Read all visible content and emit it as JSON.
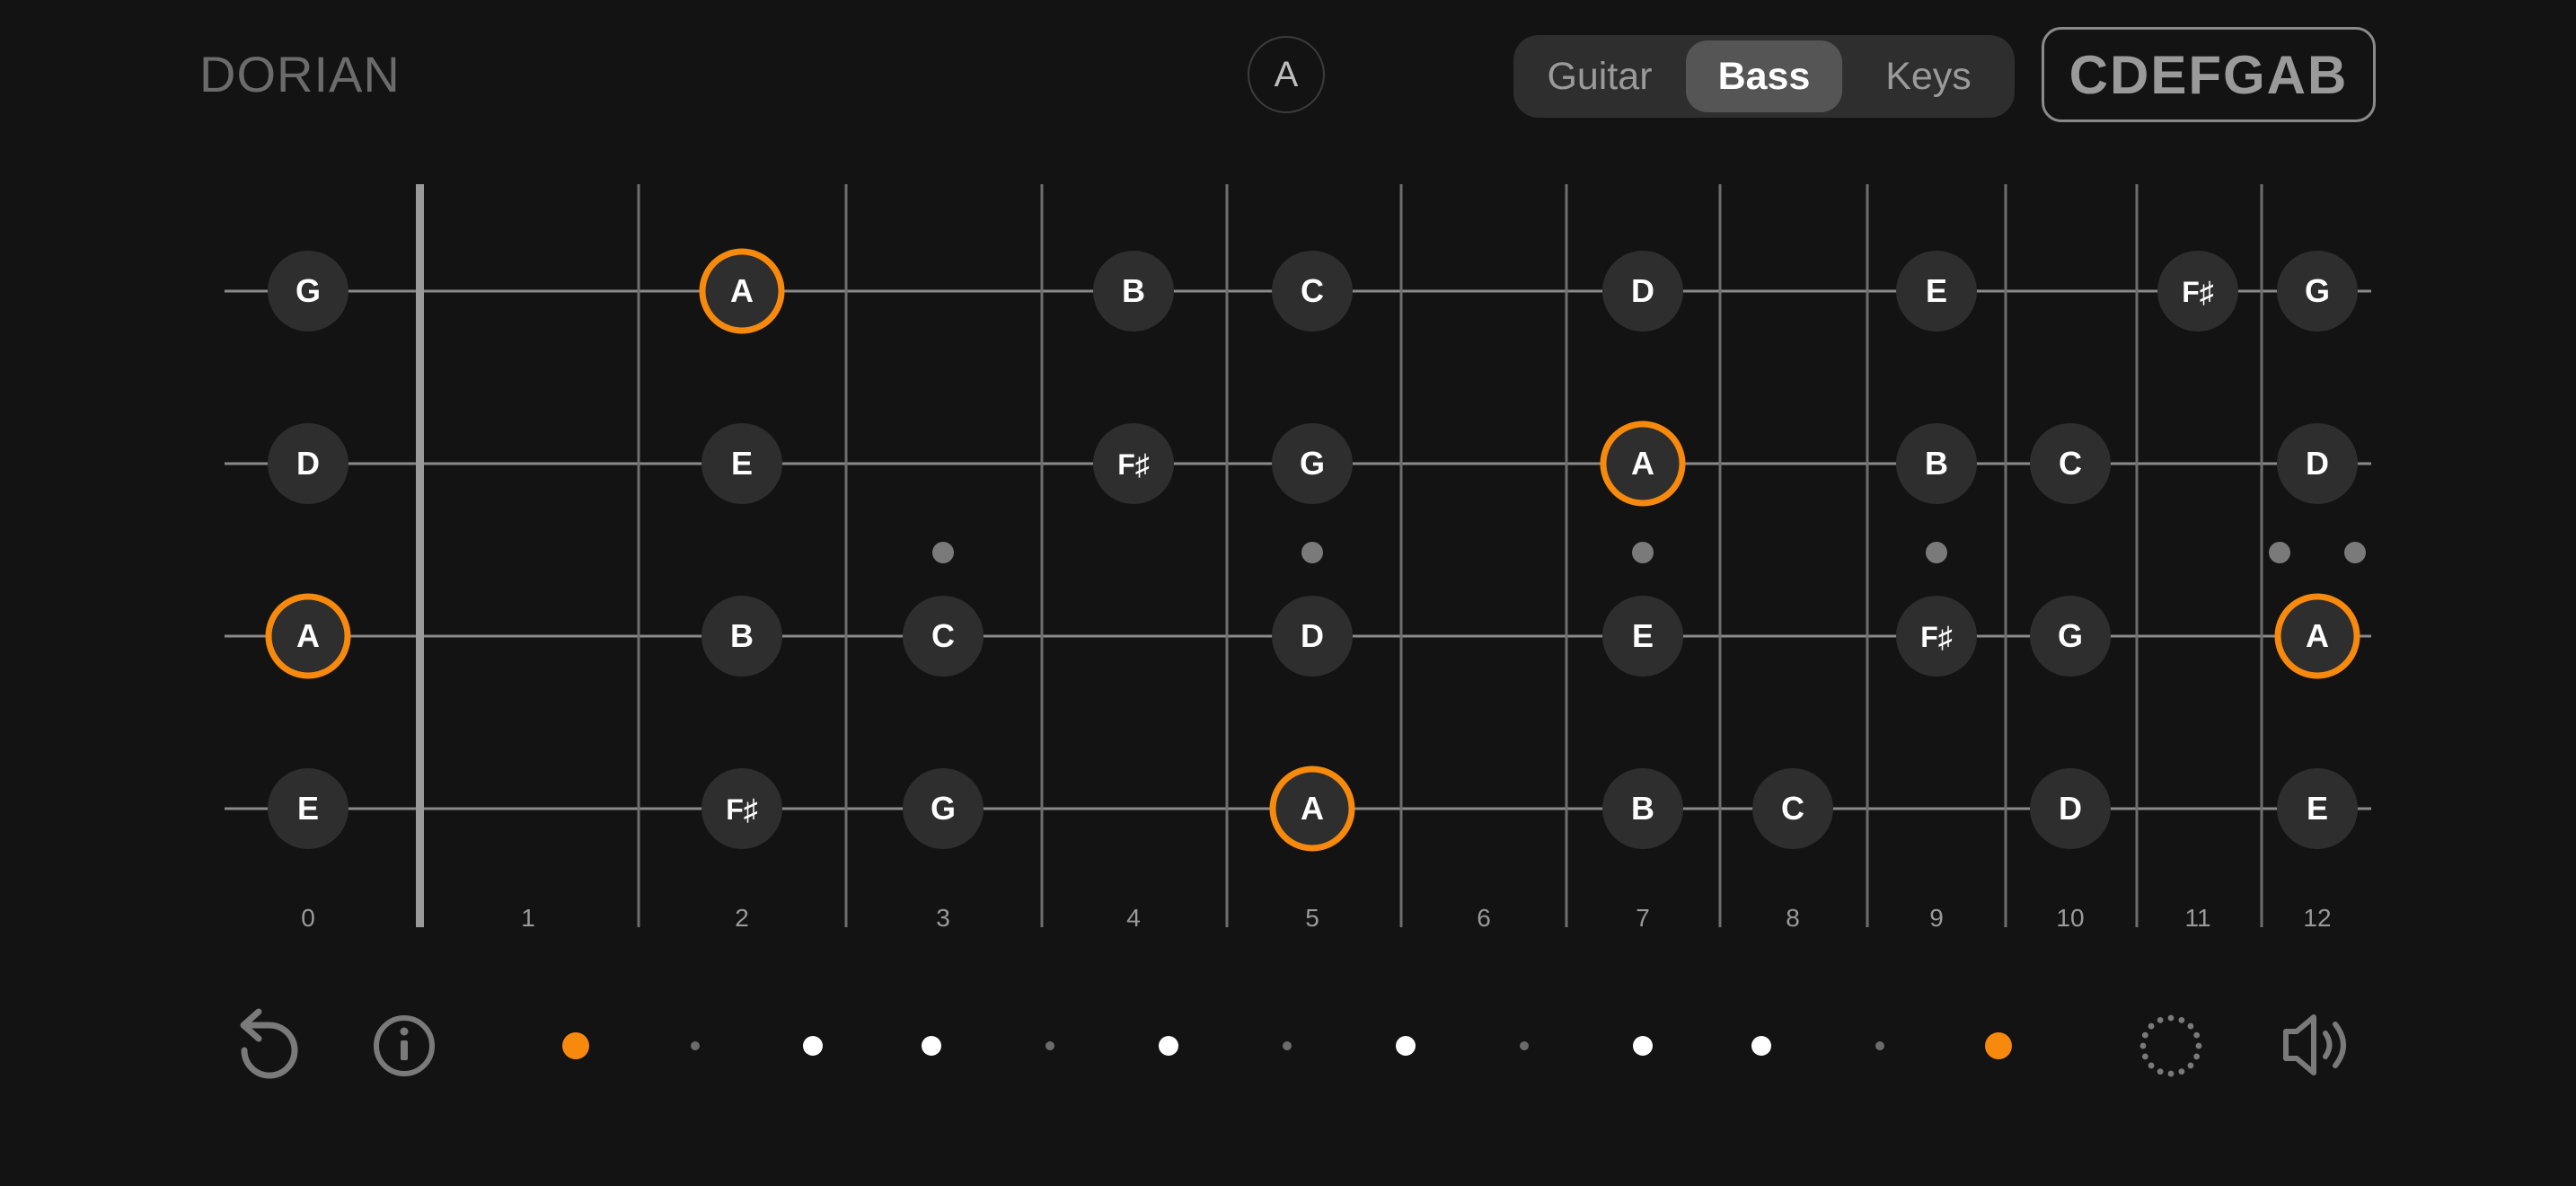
{
  "header": {
    "mode": "DORIAN",
    "root_note": "A",
    "instruments": [
      {
        "label": "Guitar",
        "active": false
      },
      {
        "label": "Bass",
        "active": true
      },
      {
        "label": "Keys",
        "active": false
      }
    ],
    "scale_notes": "CDEFGAB"
  },
  "colors": {
    "background": "#131313",
    "accent": "#f7890c",
    "note_fill": "#2e2e2e",
    "string": "#8a8a8a",
    "fret": "#6e6e6e",
    "nut": "#9a9a9a",
    "marker": "#7a7a7a"
  },
  "fretboard": {
    "fret_numbers": [
      "0",
      "1",
      "2",
      "3",
      "4",
      "5",
      "6",
      "7",
      "8",
      "9",
      "10",
      "11",
      "12"
    ],
    "inlay_frets": [
      3,
      5,
      7,
      9
    ],
    "double_inlay_fret": 12,
    "strings": [
      {
        "name": "G",
        "notes": [
          {
            "fret": 0,
            "label": "G"
          },
          {
            "fret": 2,
            "label": "A",
            "root": true
          },
          {
            "fret": 4,
            "label": "B"
          },
          {
            "fret": 5,
            "label": "C"
          },
          {
            "fret": 7,
            "label": "D"
          },
          {
            "fret": 9,
            "label": "E"
          },
          {
            "fret": 11,
            "label": "F♯"
          },
          {
            "fret": 12,
            "label": "G"
          }
        ]
      },
      {
        "name": "D",
        "notes": [
          {
            "fret": 0,
            "label": "D"
          },
          {
            "fret": 2,
            "label": "E"
          },
          {
            "fret": 4,
            "label": "F♯"
          },
          {
            "fret": 5,
            "label": "G"
          },
          {
            "fret": 7,
            "label": "A",
            "root": true
          },
          {
            "fret": 9,
            "label": "B"
          },
          {
            "fret": 10,
            "label": "C"
          },
          {
            "fret": 12,
            "label": "D"
          }
        ]
      },
      {
        "name": "A",
        "notes": [
          {
            "fret": 0,
            "label": "A",
            "root": true
          },
          {
            "fret": 2,
            "label": "B"
          },
          {
            "fret": 3,
            "label": "C"
          },
          {
            "fret": 5,
            "label": "D"
          },
          {
            "fret": 7,
            "label": "E"
          },
          {
            "fret": 9,
            "label": "F♯"
          },
          {
            "fret": 10,
            "label": "G"
          },
          {
            "fret": 12,
            "label": "A",
            "root": true
          }
        ]
      },
      {
        "name": "E",
        "notes": [
          {
            "fret": 0,
            "label": "E"
          },
          {
            "fret": 2,
            "label": "F♯"
          },
          {
            "fret": 3,
            "label": "G"
          },
          {
            "fret": 5,
            "label": "A",
            "root": true
          },
          {
            "fret": 7,
            "label": "B"
          },
          {
            "fret": 8,
            "label": "C"
          },
          {
            "fret": 10,
            "label": "D"
          },
          {
            "fret": 12,
            "label": "E"
          }
        ]
      }
    ]
  },
  "controls": {
    "icons": {
      "left": [
        "replay-icon",
        "info-icon"
      ],
      "right": [
        "loading-spinner-icon",
        "speaker-icon"
      ]
    },
    "scale_steps": [
      "root",
      "off",
      "on",
      "on",
      "off",
      "on",
      "off",
      "on",
      "off",
      "on",
      "on",
      "off",
      "root"
    ]
  }
}
